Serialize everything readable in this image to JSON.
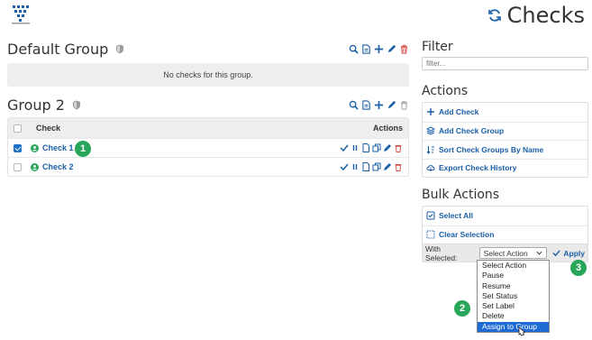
{
  "header": {
    "title": "Checks"
  },
  "groups": [
    {
      "title": "Default Group",
      "empty_text": "No checks for this group."
    },
    {
      "title": "Group 2",
      "table": {
        "col_check": "Check",
        "col_actions": "Actions",
        "rows": [
          {
            "name": "Check 1",
            "checked": true,
            "status": "up"
          },
          {
            "name": "Check 2",
            "checked": false,
            "status": "up"
          }
        ]
      }
    }
  ],
  "sidebar": {
    "filter_title": "Filter",
    "filter_placeholder": "filter...",
    "actions_title": "Actions",
    "actions": [
      "Add Check",
      "Add Check Group",
      "Sort Check Groups By Name",
      "Export Check History"
    ],
    "bulk_title": "Bulk Actions",
    "bulk_items": [
      "Select All",
      "Clear Selection"
    ],
    "with_selected_label": "With Selected:",
    "select_value": "Select Action",
    "apply_label": "Apply"
  },
  "dropdown_options": [
    "Select Action",
    "Pause",
    "Resume",
    "Set Status",
    "Set Label",
    "Delete",
    "Assign to Group"
  ],
  "dropdown_highlighted": "Assign to Group",
  "callouts": [
    "1",
    "2",
    "3"
  ],
  "colors": {
    "link": "#1a5fa8",
    "delete": "#d9534f",
    "status_green": "#2aa65a",
    "callout": "#2aa65a",
    "highlight": "#1e6bd6"
  }
}
